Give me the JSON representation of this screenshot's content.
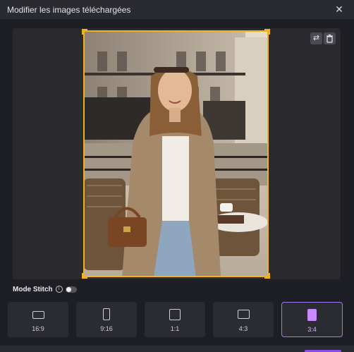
{
  "window": {
    "title": "Modifier les images téléchargées",
    "close_glyph": "✕"
  },
  "preview": {
    "toolbar": {
      "swap_icon": "swap-icon",
      "swap_glyph": "⇄",
      "trash_icon": "trash-icon",
      "trash_glyph": "🗑"
    },
    "image_alt": "Portrait photo of a woman seated at a Parisian café terrace",
    "crop_color": "#f1b21a"
  },
  "stitch": {
    "label": "Mode Stitch",
    "info_glyph": "i",
    "enabled": false
  },
  "ratios": [
    {
      "label": "16:9",
      "selected": false
    },
    {
      "label": "9:16",
      "selected": false
    },
    {
      "label": "1:1",
      "selected": false
    },
    {
      "label": "4:3",
      "selected": false
    },
    {
      "label": "3:4",
      "selected": true
    }
  ],
  "colors": {
    "accent": "#a575ea",
    "selected_fill": "#c58bff",
    "background": "#1e1f24"
  }
}
